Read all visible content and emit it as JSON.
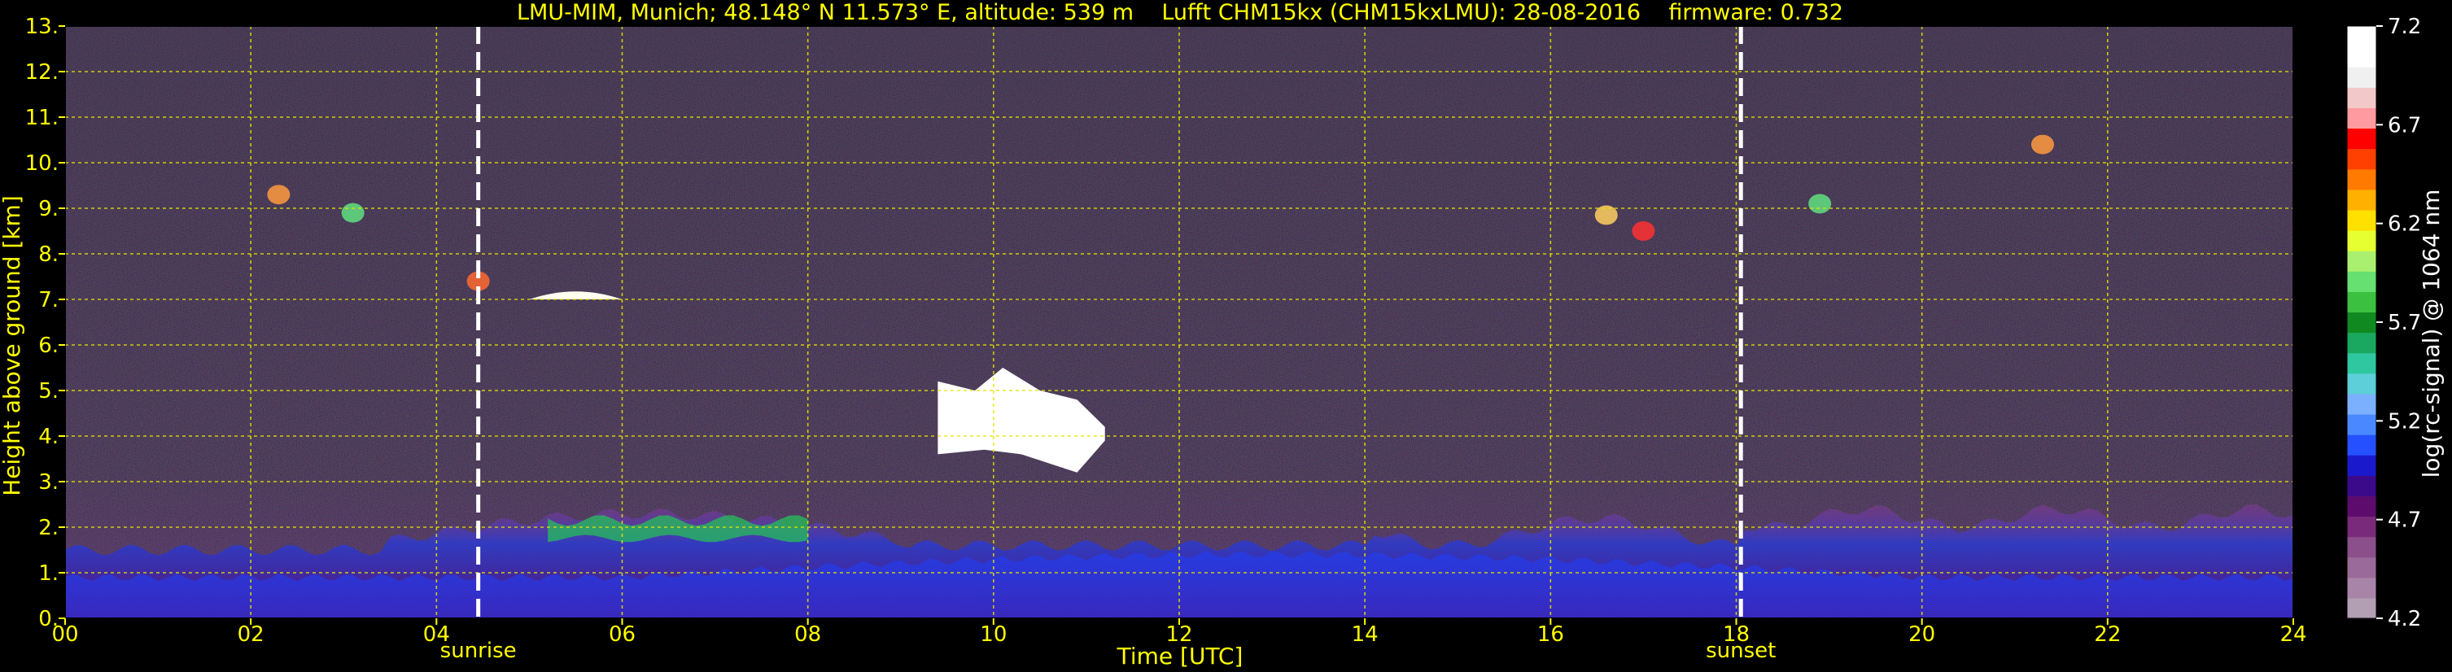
{
  "chart_data": {
    "type": "heatmap",
    "title": "LMU-MIM, Munich; 48.148° N 11.573° E, altitude: 539 m    Lufft CHM15kx (CHM15kxLMU): 28-08-2016    firmware: 0.732",
    "xlabel": "Time [UTC]",
    "ylabel": "Height above ground [km]",
    "x_ticks": [
      "00",
      "02",
      "04",
      "06",
      "08",
      "10",
      "12",
      "14",
      "16",
      "18",
      "20",
      "22",
      "24"
    ],
    "x_tick_values": [
      0,
      2,
      4,
      6,
      8,
      10,
      12,
      14,
      16,
      18,
      20,
      22,
      24
    ],
    "y_ticks": [
      "0.",
      "1.",
      "2.",
      "3.",
      "4.",
      "5.",
      "6.",
      "7.",
      "8.",
      "9.",
      "10.",
      "11.",
      "12.",
      "13."
    ],
    "y_tick_values": [
      0,
      1,
      2,
      3,
      4,
      5,
      6,
      7,
      8,
      9,
      10,
      11,
      12,
      13
    ],
    "xlim": [
      0,
      24
    ],
    "ylim": [
      0,
      13
    ],
    "grid": true,
    "markers": [
      {
        "label": "sunrise",
        "x": 4.45
      },
      {
        "label": "sunset",
        "x": 18.05
      }
    ],
    "colorbar": {
      "label": "log(rc-signal) @ 1064 nm",
      "range": [
        4.2,
        7.2
      ],
      "ticks": [
        "4.2",
        "4.7",
        "5.2",
        "5.7",
        "6.2",
        "6.7",
        "7.2"
      ],
      "tick_values": [
        4.2,
        4.7,
        5.2,
        5.7,
        6.2,
        6.7,
        7.2
      ],
      "colors": [
        "#b39fb3",
        "#a885a8",
        "#9a6a9a",
        "#8b4f8b",
        "#7a2a7a",
        "#5e0b6e",
        "#3a0a8a",
        "#1a1acc",
        "#2450ff",
        "#4a88ff",
        "#7bb0ff",
        "#5ccfd8",
        "#2ec7a0",
        "#1aa860",
        "#108a20",
        "#3cc040",
        "#66e070",
        "#aaf070",
        "#e6ff30",
        "#ffe000",
        "#ffb000",
        "#ff7a00",
        "#ff4000",
        "#ff0000",
        "#ff9aa0",
        "#f2c8c8",
        "#f0f0f0",
        "#ffffff",
        "#ffffff"
      ]
    }
  }
}
